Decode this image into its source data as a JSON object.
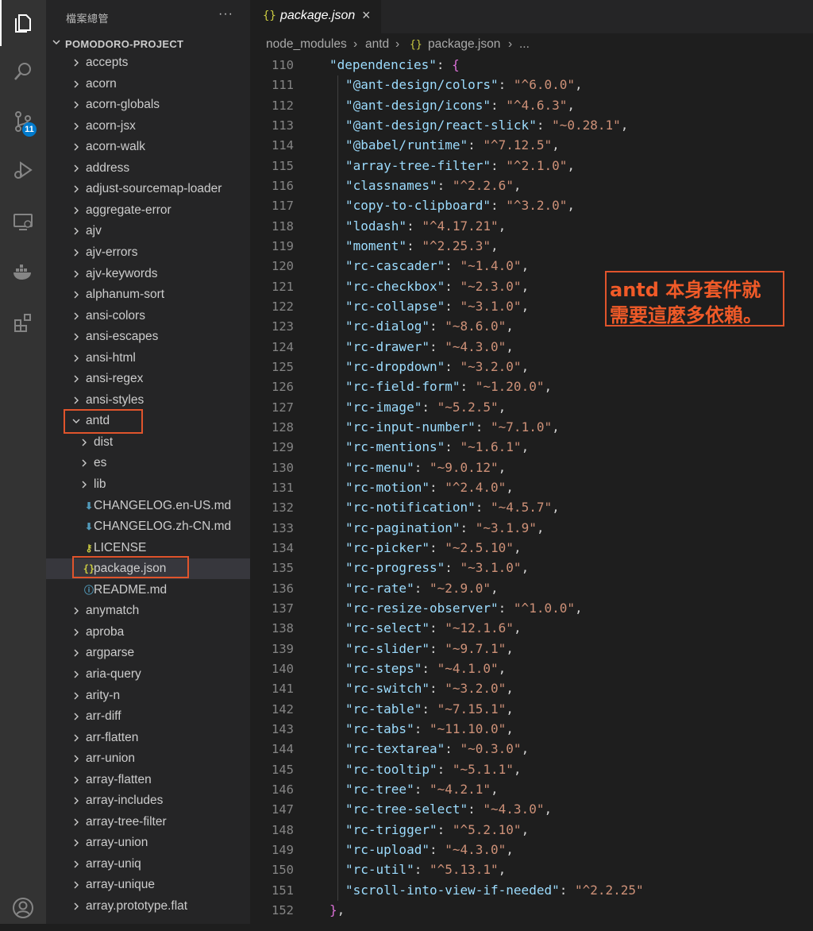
{
  "activity_bar": {
    "items": [
      {
        "icon": "files-icon",
        "active": true
      },
      {
        "icon": "search-icon"
      },
      {
        "icon": "source-control-icon",
        "badge": "11"
      },
      {
        "icon": "run-debug-icon"
      },
      {
        "icon": "remote-explorer-icon"
      },
      {
        "icon": "docker-icon"
      },
      {
        "icon": "extensions-icon"
      }
    ],
    "account_icon": "account-icon"
  },
  "sidebar": {
    "title": "檔案總管",
    "more_label": "···",
    "project": "POMODORO-PROJECT",
    "tree": [
      {
        "label": "accepts",
        "type": "folder",
        "level": 1
      },
      {
        "label": "acorn",
        "type": "folder",
        "level": 1
      },
      {
        "label": "acorn-globals",
        "type": "folder",
        "level": 1
      },
      {
        "label": "acorn-jsx",
        "type": "folder",
        "level": 1
      },
      {
        "label": "acorn-walk",
        "type": "folder",
        "level": 1
      },
      {
        "label": "address",
        "type": "folder",
        "level": 1
      },
      {
        "label": "adjust-sourcemap-loader",
        "type": "folder",
        "level": 1
      },
      {
        "label": "aggregate-error",
        "type": "folder",
        "level": 1
      },
      {
        "label": "ajv",
        "type": "folder",
        "level": 1
      },
      {
        "label": "ajv-errors",
        "type": "folder",
        "level": 1
      },
      {
        "label": "ajv-keywords",
        "type": "folder",
        "level": 1
      },
      {
        "label": "alphanum-sort",
        "type": "folder",
        "level": 1
      },
      {
        "label": "ansi-colors",
        "type": "folder",
        "level": 1
      },
      {
        "label": "ansi-escapes",
        "type": "folder",
        "level": 1
      },
      {
        "label": "ansi-html",
        "type": "folder",
        "level": 1
      },
      {
        "label": "ansi-regex",
        "type": "folder",
        "level": 1
      },
      {
        "label": "ansi-styles",
        "type": "folder",
        "level": 1
      },
      {
        "label": "antd",
        "type": "folder-open",
        "level": 1,
        "highlight": true
      },
      {
        "label": "dist",
        "type": "folder",
        "level": 2
      },
      {
        "label": "es",
        "type": "folder",
        "level": 2
      },
      {
        "label": "lib",
        "type": "folder",
        "level": 2
      },
      {
        "label": "CHANGELOG.en-US.md",
        "type": "file",
        "icon": "markdown-arrow-icon",
        "level": 2
      },
      {
        "label": "CHANGELOG.zh-CN.md",
        "type": "file",
        "icon": "markdown-arrow-icon",
        "level": 2
      },
      {
        "label": "LICENSE",
        "type": "file",
        "icon": "license-icon",
        "level": 2
      },
      {
        "label": "package.json",
        "type": "file",
        "icon": "json-icon",
        "level": 2,
        "selected": true,
        "highlight": true
      },
      {
        "label": "README.md",
        "type": "file",
        "icon": "info-icon",
        "level": 2
      },
      {
        "label": "anymatch",
        "type": "folder",
        "level": 1
      },
      {
        "label": "aproba",
        "type": "folder",
        "level": 1
      },
      {
        "label": "argparse",
        "type": "folder",
        "level": 1
      },
      {
        "label": "aria-query",
        "type": "folder",
        "level": 1
      },
      {
        "label": "arity-n",
        "type": "folder",
        "level": 1
      },
      {
        "label": "arr-diff",
        "type": "folder",
        "level": 1
      },
      {
        "label": "arr-flatten",
        "type": "folder",
        "level": 1
      },
      {
        "label": "arr-union",
        "type": "folder",
        "level": 1
      },
      {
        "label": "array-flatten",
        "type": "folder",
        "level": 1
      },
      {
        "label": "array-includes",
        "type": "folder",
        "level": 1
      },
      {
        "label": "array-tree-filter",
        "type": "folder",
        "level": 1
      },
      {
        "label": "array-union",
        "type": "folder",
        "level": 1
      },
      {
        "label": "array-uniq",
        "type": "folder",
        "level": 1
      },
      {
        "label": "array-unique",
        "type": "folder",
        "level": 1
      },
      {
        "label": "array.prototype.flat",
        "type": "folder",
        "level": 1
      }
    ]
  },
  "editor": {
    "tab": {
      "icon": "{}",
      "label": "package.json",
      "close": "×"
    },
    "breadcrumb": [
      "node_modules",
      "antd",
      "{}",
      "package.json",
      "..."
    ],
    "lines": [
      {
        "n": "110",
        "text": "\"dependencies\": {",
        "kind": "open"
      },
      {
        "n": "111",
        "key": "@ant-design/colors",
        "value": "^6.0.0"
      },
      {
        "n": "112",
        "key": "@ant-design/icons",
        "value": "^4.6.3"
      },
      {
        "n": "113",
        "key": "@ant-design/react-slick",
        "value": "~0.28.1"
      },
      {
        "n": "114",
        "key": "@babel/runtime",
        "value": "^7.12.5"
      },
      {
        "n": "115",
        "key": "array-tree-filter",
        "value": "^2.1.0"
      },
      {
        "n": "116",
        "key": "classnames",
        "value": "^2.2.6"
      },
      {
        "n": "117",
        "key": "copy-to-clipboard",
        "value": "^3.2.0"
      },
      {
        "n": "118",
        "key": "lodash",
        "value": "^4.17.21"
      },
      {
        "n": "119",
        "key": "moment",
        "value": "^2.25.3"
      },
      {
        "n": "120",
        "key": "rc-cascader",
        "value": "~1.4.0"
      },
      {
        "n": "121",
        "key": "rc-checkbox",
        "value": "~2.3.0"
      },
      {
        "n": "122",
        "key": "rc-collapse",
        "value": "~3.1.0"
      },
      {
        "n": "123",
        "key": "rc-dialog",
        "value": "~8.6.0"
      },
      {
        "n": "124",
        "key": "rc-drawer",
        "value": "~4.3.0"
      },
      {
        "n": "125",
        "key": "rc-dropdown",
        "value": "~3.2.0"
      },
      {
        "n": "126",
        "key": "rc-field-form",
        "value": "~1.20.0"
      },
      {
        "n": "127",
        "key": "rc-image",
        "value": "~5.2.5"
      },
      {
        "n": "128",
        "key": "rc-input-number",
        "value": "~7.1.0"
      },
      {
        "n": "129",
        "key": "rc-mentions",
        "value": "~1.6.1"
      },
      {
        "n": "130",
        "key": "rc-menu",
        "value": "~9.0.12"
      },
      {
        "n": "131",
        "key": "rc-motion",
        "value": "^2.4.0"
      },
      {
        "n": "132",
        "key": "rc-notification",
        "value": "~4.5.7"
      },
      {
        "n": "133",
        "key": "rc-pagination",
        "value": "~3.1.9"
      },
      {
        "n": "134",
        "key": "rc-picker",
        "value": "~2.5.10"
      },
      {
        "n": "135",
        "key": "rc-progress",
        "value": "~3.1.0"
      },
      {
        "n": "136",
        "key": "rc-rate",
        "value": "~2.9.0"
      },
      {
        "n": "137",
        "key": "rc-resize-observer",
        "value": "^1.0.0"
      },
      {
        "n": "138",
        "key": "rc-select",
        "value": "~12.1.6"
      },
      {
        "n": "139",
        "key": "rc-slider",
        "value": "~9.7.1"
      },
      {
        "n": "140",
        "key": "rc-steps",
        "value": "~4.1.0"
      },
      {
        "n": "141",
        "key": "rc-switch",
        "value": "~3.2.0"
      },
      {
        "n": "142",
        "key": "rc-table",
        "value": "~7.15.1"
      },
      {
        "n": "143",
        "key": "rc-tabs",
        "value": "~11.10.0"
      },
      {
        "n": "144",
        "key": "rc-textarea",
        "value": "~0.3.0"
      },
      {
        "n": "145",
        "key": "rc-tooltip",
        "value": "~5.1.1"
      },
      {
        "n": "146",
        "key": "rc-tree",
        "value": "~4.2.1"
      },
      {
        "n": "147",
        "key": "rc-tree-select",
        "value": "~4.3.0"
      },
      {
        "n": "148",
        "key": "rc-trigger",
        "value": "^5.2.10"
      },
      {
        "n": "149",
        "key": "rc-upload",
        "value": "~4.3.0"
      },
      {
        "n": "150",
        "key": "rc-util",
        "value": "^5.13.1"
      },
      {
        "n": "151",
        "key": "scroll-into-view-if-needed",
        "value": "^2.2.25",
        "last": true
      },
      {
        "n": "152",
        "text": "},",
        "kind": "close"
      }
    ],
    "annotation": [
      "antd 本身套件就",
      "需要這麼多依賴。"
    ]
  },
  "colors": {
    "highlight_border": "#e0542c",
    "annotation_text": "#f05a28",
    "json_key": "#9cdcfe",
    "json_string": "#ce9178",
    "bracket": "#da70d6",
    "json_icon": "#cbcb41",
    "markdown_icon": "#519aba",
    "badge": "#007acc"
  }
}
